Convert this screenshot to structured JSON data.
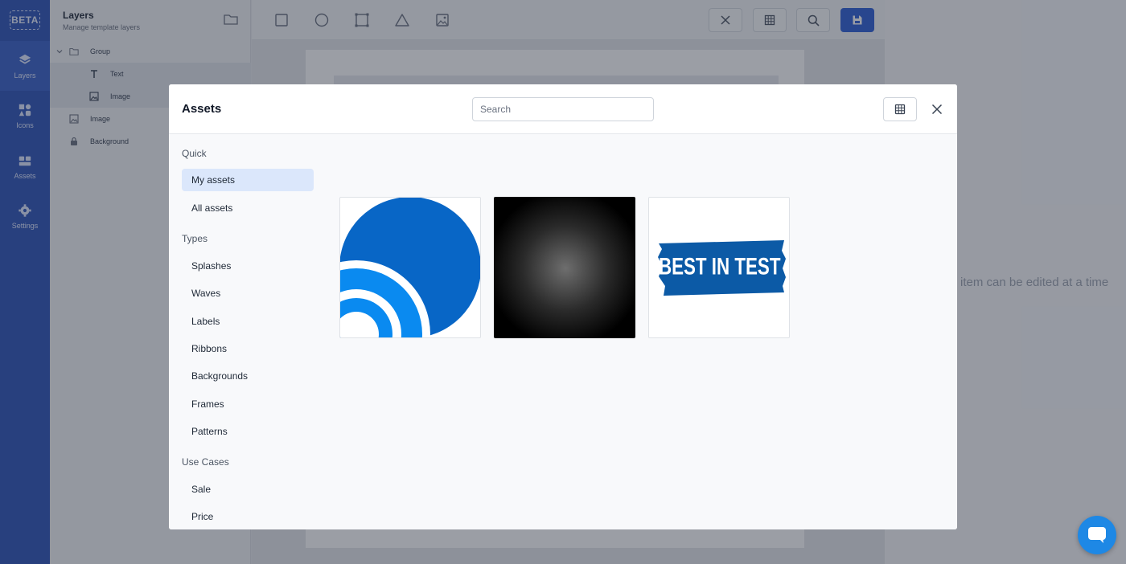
{
  "app": {
    "beta_label": "BETA",
    "rail": [
      {
        "label": "Layers",
        "icon": "layers-icon"
      },
      {
        "label": "Icons",
        "icon": "shapes-icon"
      },
      {
        "label": "Assets",
        "icon": "assets-icon"
      },
      {
        "label": "Settings",
        "icon": "gear-icon"
      }
    ]
  },
  "layers": {
    "title": "Layers",
    "subtitle": "Manage template layers",
    "items": [
      {
        "label": "Group",
        "icon": "folder-icon"
      },
      {
        "label": "Text",
        "icon": "text-icon"
      },
      {
        "label": "Image",
        "icon": "image-icon"
      },
      {
        "label": "Image",
        "icon": "image-icon"
      },
      {
        "label": "Background",
        "icon": "lock-icon"
      }
    ]
  },
  "toolbar": {
    "tools": [
      "rectangle-icon",
      "circle-icon",
      "frame-icon",
      "triangle-icon",
      "image-icon"
    ],
    "actions": [
      "close-icon",
      "grid-icon",
      "search-icon",
      "save-icon"
    ]
  },
  "right_panel": {
    "message": "item can be edited at a time"
  },
  "modal": {
    "title": "Assets",
    "search_placeholder": "Search",
    "sections": [
      {
        "heading": "Quick",
        "items": [
          "My assets",
          "All assets"
        ]
      },
      {
        "heading": "Types",
        "items": [
          "Splashes",
          "Waves",
          "Labels",
          "Ribbons",
          "Backgrounds",
          "Frames",
          "Patterns"
        ]
      },
      {
        "heading": "Use Cases",
        "items": [
          "Sale",
          "Price"
        ]
      }
    ],
    "active_item": "My assets",
    "assets": [
      {
        "kind": "blue-waves-graphic"
      },
      {
        "kind": "radial-gradient-graphic"
      },
      {
        "kind": "ribbon-label-graphic",
        "text": "BEST IN TEST"
      }
    ]
  },
  "colors": {
    "accent": "#2f5fd6",
    "rail": "#2f55b9",
    "active_category": "#dbe7fb",
    "asset_blue": "#0866c6",
    "asset_light_blue": "#0a8af0"
  }
}
